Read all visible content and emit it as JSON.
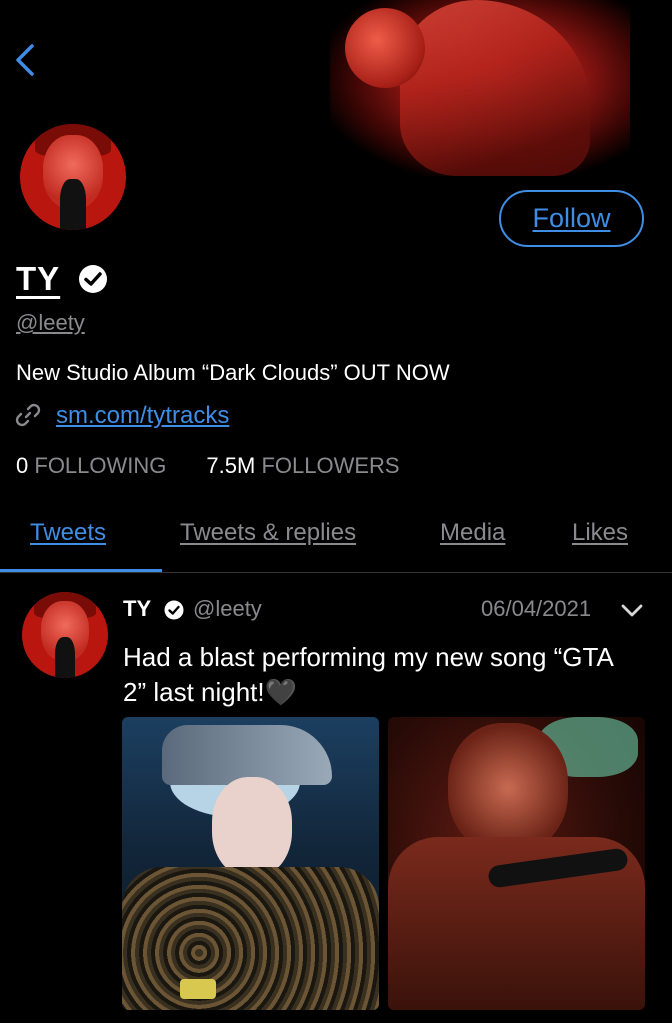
{
  "profile": {
    "name": "TY",
    "handle": "@leety",
    "bio": "New Studio Album “Dark Clouds” OUT NOW",
    "link": "sm.com/tytracks",
    "following_count": "0",
    "following_label": "FOLLOWING",
    "followers_count": "7.5M",
    "followers_label": "FOLLOWERS",
    "follow_button": "Follow"
  },
  "tabs": [
    {
      "label": "Tweets",
      "active": true
    },
    {
      "label": "Tweets & replies",
      "active": false
    },
    {
      "label": "Media",
      "active": false
    },
    {
      "label": "Likes",
      "active": false
    }
  ],
  "tweet": {
    "name": "TY",
    "handle": "@leety",
    "date": "06/04/2021",
    "text": "Had a blast performing my new song “GTA 2” last night!🖤"
  },
  "colors": {
    "accent": "#3f8de4",
    "background": "#000000",
    "secondary_text": "#8a8a8e"
  }
}
